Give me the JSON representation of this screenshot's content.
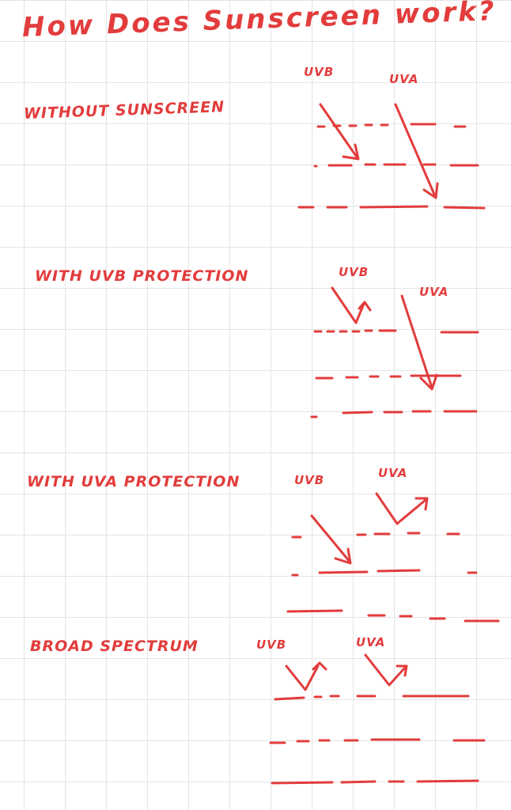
{
  "title": "How Does Sunscreen work?",
  "sections": [
    {
      "label": "WITHOUT SUNSCREEN",
      "uvb_label": "UVB",
      "uva_label": "UVA"
    },
    {
      "label": "WITH UVB PROTECTION",
      "uvb_label": "UVB",
      "uva_label": "UVA"
    },
    {
      "label": "WITH UVA PROTECTION",
      "uvb_label": "UVB",
      "uva_label": "UVA"
    },
    {
      "label": "BROAD SPECTRUM",
      "uvb_label": "UVB",
      "uva_label": "UVA"
    }
  ],
  "colors": {
    "ink": "#e23c3c",
    "grid": "#e4e4e4",
    "paper": "#ffffff"
  }
}
